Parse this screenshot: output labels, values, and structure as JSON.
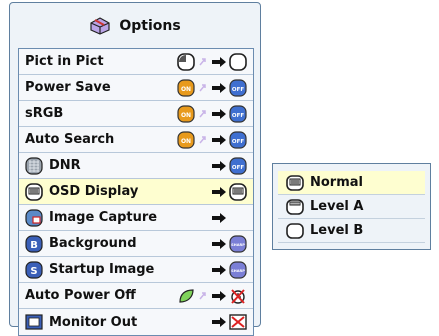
{
  "menu": {
    "title": "Options",
    "items": [
      {
        "label": "Pict in Pict",
        "state": "off_to_on",
        "icon": null
      },
      {
        "label": "Power Save",
        "state": "on_to_off",
        "icon": null
      },
      {
        "label": "sRGB",
        "state": "on_to_off",
        "icon": null
      },
      {
        "label": "Auto Search",
        "state": "on_to_off",
        "icon": null
      },
      {
        "label": "DNR",
        "state": "to_off",
        "icon": "dnr-icon"
      },
      {
        "label": "OSD Display",
        "state": "to_osd",
        "icon": "osd-icon",
        "selected": true
      },
      {
        "label": "Image Capture",
        "state": "to_none",
        "icon": "image-capture-icon"
      },
      {
        "label": "Background",
        "state": "to_sharp",
        "icon": "background-icon"
      },
      {
        "label": "Startup Image",
        "state": "to_sharp",
        "icon": "startup-image-icon"
      },
      {
        "label": "Auto Power Off",
        "state": "leaf_to_clock",
        "icon": null
      },
      {
        "label": "Monitor Out",
        "state": "to_crossed_monitor",
        "icon": "monitor-out-icon"
      }
    ]
  },
  "submenu": {
    "items": [
      {
        "label": "Normal",
        "icon": "osd-normal-icon",
        "selected": true
      },
      {
        "label": "Level A",
        "icon": "osd-level-a-icon"
      },
      {
        "label": "Level B",
        "icon": "osd-level-b-icon"
      }
    ]
  },
  "badges": {
    "on": "ON",
    "off": "OFF",
    "sharp": "SHARP"
  },
  "colors": {
    "on_badge": "#e89a1c",
    "off_badge": "#3f6fd0",
    "selected_row": "#fefed0",
    "menu_bg": "#eef3f8",
    "border": "#5f7f9f"
  }
}
